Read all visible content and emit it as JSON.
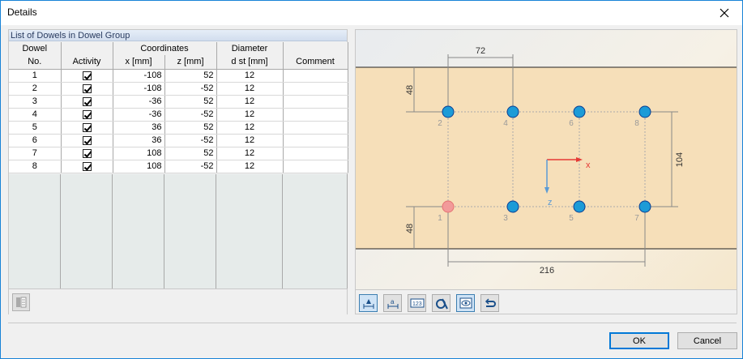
{
  "window": {
    "title": "Details"
  },
  "group": {
    "title": "List of Dowels in Dowel Group"
  },
  "table": {
    "h1": {
      "dowel": "Dowel",
      "coordinates": "Coordinates",
      "diameter": "Diameter"
    },
    "h2": {
      "no": "No.",
      "activity": "Activity",
      "x": "x [mm]",
      "z": "z [mm]",
      "dst": "d st [mm]",
      "comment": "Comment"
    },
    "rows": [
      {
        "no": "1",
        "x": "-108",
        "z": "52",
        "d": "12"
      },
      {
        "no": "2",
        "x": "-108",
        "z": "-52",
        "d": "12"
      },
      {
        "no": "3",
        "x": "-36",
        "z": "52",
        "d": "12"
      },
      {
        "no": "4",
        "x": "-36",
        "z": "-52",
        "d": "12"
      },
      {
        "no": "5",
        "x": "36",
        "z": "52",
        "d": "12"
      },
      {
        "no": "6",
        "x": "36",
        "z": "-52",
        "d": "12"
      },
      {
        "no": "7",
        "x": "108",
        "z": "52",
        "d": "12"
      },
      {
        "no": "8",
        "x": "108",
        "z": "-52",
        "d": "12"
      }
    ]
  },
  "graphic": {
    "dims": {
      "top": "72",
      "left_top": "48",
      "left_bottom": "48",
      "right": "104",
      "bottom": "216"
    },
    "axis": {
      "x": "x",
      "z": "z"
    },
    "labels": {
      "d1": "1",
      "d2": "2",
      "d3": "3",
      "d4": "4",
      "d5": "5",
      "d6": "6",
      "d7": "7",
      "d8": "8"
    },
    "colors": {
      "dowel": "#1c9bd7",
      "selected": "#f29a9a",
      "background": "#f6dfb9"
    }
  },
  "buttons": {
    "ok": "OK",
    "cancel": "Cancel"
  }
}
